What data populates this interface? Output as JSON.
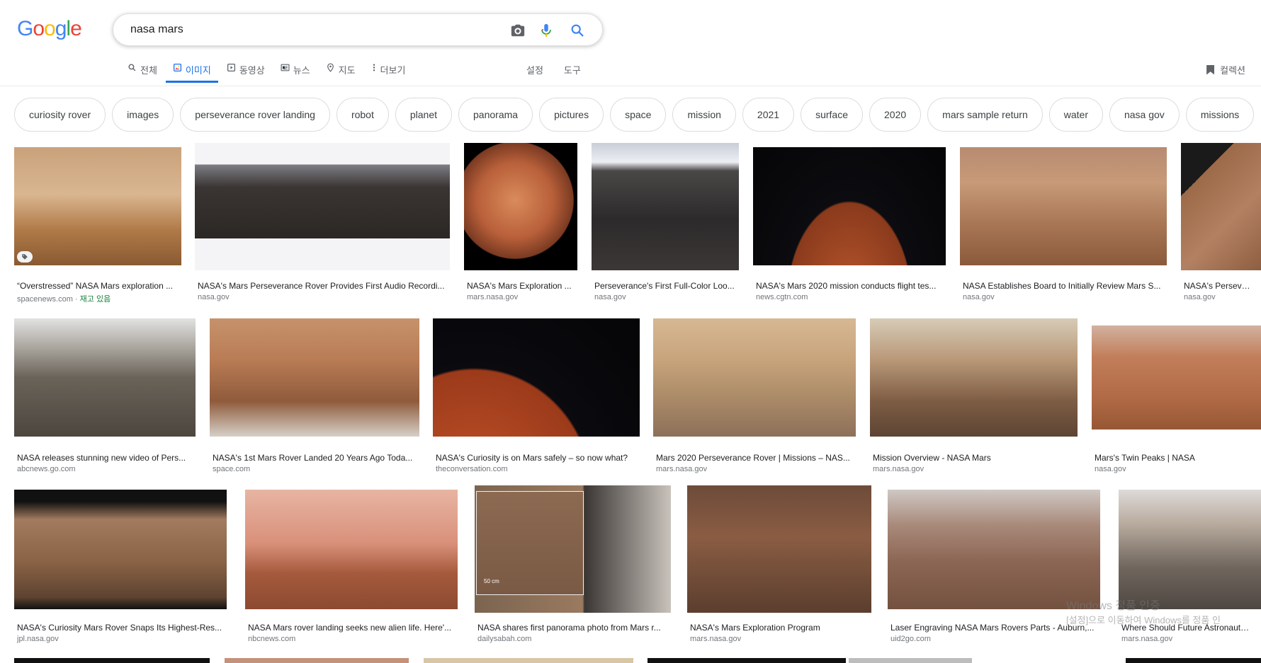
{
  "logo": {
    "letters": [
      "G",
      "o",
      "o",
      "g",
      "l",
      "e"
    ],
    "colors": [
      "#4285F4",
      "#EA4335",
      "#FBBC05",
      "#4285F4",
      "#34A853",
      "#EA4335"
    ]
  },
  "search": {
    "query": "nasa mars"
  },
  "tabs": [
    {
      "label": "전체",
      "icon": "search-icon",
      "active": false
    },
    {
      "label": "이미지",
      "icon": "image-icon",
      "active": true
    },
    {
      "label": "동영상",
      "icon": "video-icon",
      "active": false
    },
    {
      "label": "뉴스",
      "icon": "news-icon",
      "active": false
    },
    {
      "label": "지도",
      "icon": "map-pin-icon",
      "active": false
    },
    {
      "label": "더보기",
      "icon": "more-vert-icon",
      "active": false
    }
  ],
  "tools": {
    "settings": "설정",
    "tools": "도구"
  },
  "collections": {
    "label": "컬렉션"
  },
  "chips": [
    "curiosity rover",
    "images",
    "perseverance rover landing",
    "robot",
    "planet",
    "panorama",
    "pictures",
    "space",
    "mission",
    "2021",
    "surface",
    "2020",
    "mars sample return",
    "water",
    "nasa gov",
    "missions"
  ],
  "results": [
    {
      "title": "“Overstressed” NASA Mars exploration ...",
      "source": "spacenews.com",
      "stock": "재고 있음"
    },
    {
      "title": "NASA's Mars Perseverance Rover Provides First Audio Recordi...",
      "source": "nasa.gov"
    },
    {
      "title": "NASA's Mars Exploration ...",
      "source": "mars.nasa.gov"
    },
    {
      "title": "Perseverance's First Full-Color Loo...",
      "source": "nasa.gov"
    },
    {
      "title": "NASA's Mars 2020 mission conducts flight tes...",
      "source": "news.cgtn.com"
    },
    {
      "title": "NASA Establishes Board to Initially Review Mars S...",
      "source": "nasa.gov"
    },
    {
      "title": "NASA's Perseveranc",
      "source": "nasa.gov"
    },
    {
      "title": "NASA releases stunning new video of Pers...",
      "source": "abcnews.go.com"
    },
    {
      "title": "NASA's 1st Mars Rover Landed 20 Years Ago Toda...",
      "source": "space.com"
    },
    {
      "title": "NASA's Curiosity is on Mars safely – so now what?",
      "source": "theconversation.com"
    },
    {
      "title": "Mars 2020 Perseverance Rover | Missions – NAS...",
      "source": "mars.nasa.gov"
    },
    {
      "title": "Mission Overview - NASA Mars",
      "source": "mars.nasa.gov"
    },
    {
      "title": "Mars's Twin Peaks | NASA",
      "source": "nasa.gov"
    },
    {
      "title": "NASA's Curiosity Mars Rover Snaps Its Highest-Res...",
      "source": "jpl.nasa.gov"
    },
    {
      "title": "NASA Mars rover landing seeks new alien life. Here'...",
      "source": "nbcnews.com"
    },
    {
      "title": "NASA shares first panorama photo from Mars r...",
      "source": "dailysabah.com"
    },
    {
      "title": "NASA's Mars Exploration Program",
      "source": "mars.nasa.gov"
    },
    {
      "title": "Laser Engraving NASA Mars Rovers Parts - Auburn,...",
      "source": "uid2go.com"
    },
    {
      "title": "Where Should Future Astronauts Lan",
      "source": "mars.nasa.gov"
    }
  ],
  "inset_label": "50 cm",
  "watermark": {
    "line1": "Windows 정품 인증",
    "line2": "[설정]으로 이동하여 Windows를 정품 인"
  }
}
